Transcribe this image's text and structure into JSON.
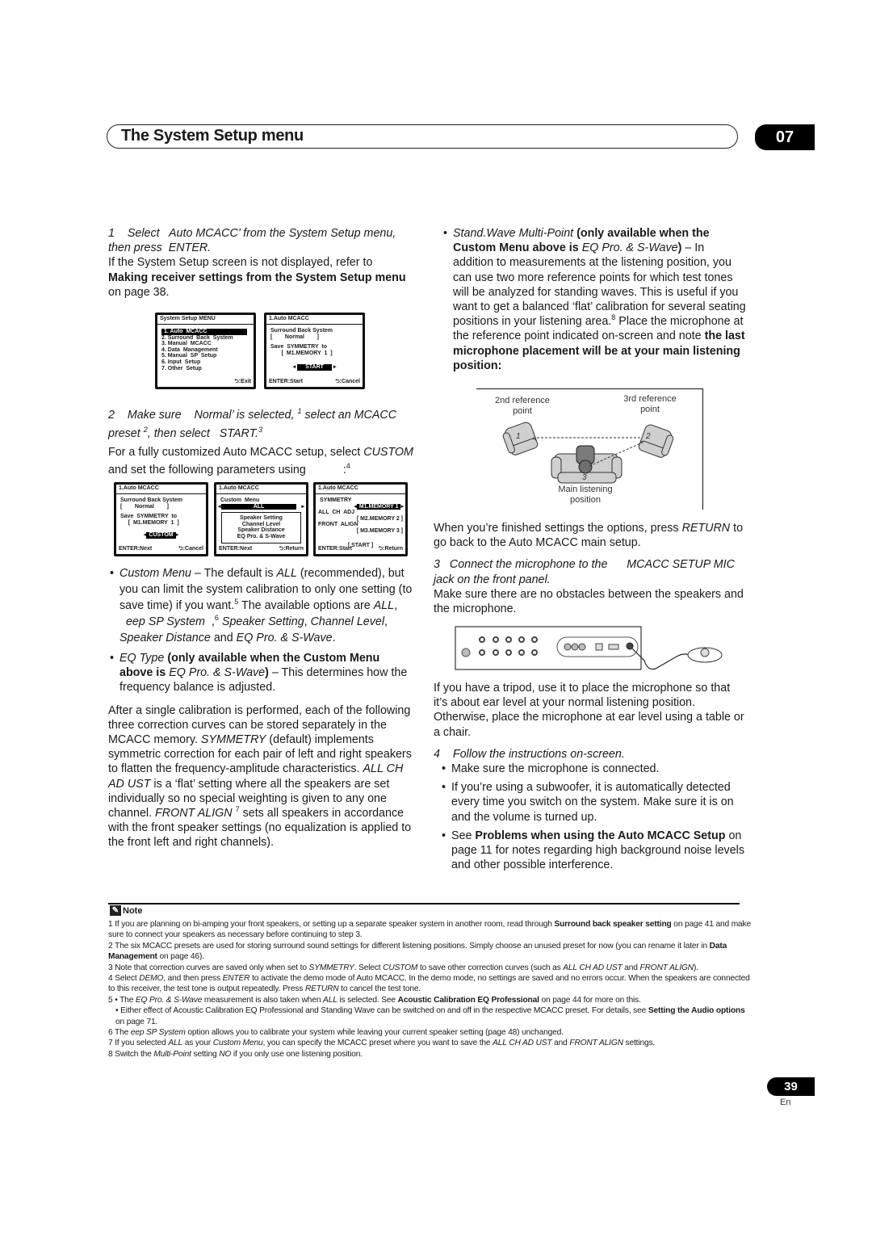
{
  "header": {
    "title": "The System Setup menu",
    "chapter": "07"
  },
  "left": {
    "step1": {
      "num": "1",
      "text_a": "Select",
      "item": "Auto MCACC",
      "text_b": "’ from the System Setup menu, then press",
      "key": "ENTER",
      "end": "."
    },
    "step1_body": {
      "a": "If the System Setup screen is not displayed, refer to",
      "link": "Making receiver settings from the System Setup menu",
      "b": "on page 38."
    },
    "osd1": {
      "title": "System  Setup  MENU",
      "items": [
        "1. Auto  MCACC",
        "2. Surround  Back  System",
        "3. Manual  MCACC",
        "4. Data  Management",
        "5. Manual  SP  Setup",
        "6. Input  Setup",
        "7. Other  Setup"
      ],
      "footer_right": ":Exit"
    },
    "osd2": {
      "title": "1.Auto  MCACC",
      "lines": [
        "Surround Back System",
        "[        Normal        ]",
        "",
        "Save  SYMMETRY  to",
        "       [  M1.MEMORY  1  ]"
      ],
      "button": "START",
      "footer_left": "ENTER:Start",
      "footer_right": ":Cancel"
    },
    "step2": {
      "num": "2",
      "a": "Make sure",
      "val": "Normal",
      "b": "’ is selected,",
      "sup1": "1",
      "c": "select an MCACC preset",
      "sup2": "2",
      "d": ", then select",
      "start": "START",
      "sup3": "3"
    },
    "step2_body": {
      "a": "For a fully customized Auto MCACC setup, select",
      "custom": "CUSTOM",
      "b": "and set the following parameters using",
      "c": ":",
      "sup": "4"
    },
    "osd3": {
      "title": "1.Auto  MCACC",
      "lines": [
        "Surround Back System",
        "[        Normal        ]",
        "",
        "Save  SYMMETRY  to",
        "     [  M1.MEMORY  1  ]"
      ],
      "button": "CUSTOM",
      "footer_left": "ENTER:Next",
      "footer_right": ":Cancel"
    },
    "osd4": {
      "title": "1.Auto  MCACC",
      "label": "Custom  Menu",
      "value": "ALL",
      "box": [
        "Speaker  Setting",
        "Channel  Level",
        "Speaker  Distance",
        "EQ  Pro. & S-Wave"
      ],
      "footer_left": "ENTER:Next",
      "footer_right": ":Return"
    },
    "osd5": {
      "title": "1.Auto  MCACC",
      "sym_label": "SYMMETRY",
      "sym_value": "M1.MEMORY  1",
      "allch_label": "ALL  CH  ADJ",
      "allch_value": "[  M2.MEMORY  2  ]",
      "front_label": "FRONT  ALIGN",
      "front_value": "[  M3.MEMORY  3  ]",
      "start": "[     START     ]",
      "footer_left": "ENTER:Start",
      "footer_right": ":Return"
    },
    "bullet_custom": {
      "term": "Custom Menu",
      "a": " – The default is ",
      "all": "ALL",
      "b": " (recommended), but you can limit the system calibration to only one setting (to save time) if you want.",
      "sup5": "5",
      "c": " The available options are ",
      "opts_all": "ALL",
      "d": ", ",
      "keep": "eep SP System",
      "e": ",",
      "sup6": "6",
      "f": " ",
      "opts_rest": "Speaker Setting",
      "g": ", ",
      "cl": "Channel Level",
      "h": ", ",
      "sd": "Speaker Distance",
      "i": " and ",
      "eq": "EQ Pro. & S-Wave",
      "j": "."
    },
    "bullet_eq": {
      "term": "EQ Type",
      "bold_a": " (only available when the Custom Menu above is ",
      "val": "EQ Pro. & S-Wave",
      "bold_b": ")",
      "rest": " – This determines how the frequency balance is adjusted."
    },
    "para": {
      "a": "After a single calibration is performed, each of the following three correction curves can be stored separately in the MCACC memory. ",
      "sym": "SYMMETRY",
      "b": " (default) implements symmetric correction for each pair of left and right speakers to flatten the frequency-amplitude characteristics. ",
      "allch": "ALL CH AD UST",
      "c": " is a ‘flat’ setting where all the speakers are set individually so no special weighting is given to any one channel. ",
      "front": "FRONT ALIGN",
      "sup7": "7",
      "d": " sets all speakers in accordance with the front speaker settings (no equalization is applied to the front left and right channels)."
    }
  },
  "right": {
    "bullet_sw": {
      "term": "Stand.Wave Multi-Point",
      "bold_a": " (only available when the Custom Menu above is ",
      "val": "EQ Pro. & S-Wave",
      "bold_b": ")",
      "a": " – In addition to measurements at the listening position, you can use two more reference points for which test tones will be analyzed for standing waves. This is useful if you want to get a balanced ‘flat’ calibration for several seating positions in your listening area.",
      "sup8": "8",
      "b": " Place the microphone at the reference point indicated on-screen and note ",
      "bold_c": "the last microphone placement will be at your main listening position:"
    },
    "diagram": {
      "label_2nd": "2nd reference point",
      "label_3rd": "3rd reference point",
      "num1": "1",
      "num2": "2",
      "num3": "3",
      "label_main": "Main listening position"
    },
    "finish": {
      "a": "When you’re finished settings the options, press ",
      "ret": "RETURN",
      "b": " to go back to the Auto MCACC main setup."
    },
    "step3": {
      "num": "3",
      "a": "Connect the microphone to the",
      "jack": "MCACC SETUP MIC",
      "b": "jack on the front panel."
    },
    "step3_body": "Make sure there are no obstacles between the speakers and the microphone.",
    "tripod": "If you have a tripod, use it to place the microphone so that it’s about ear level at your normal listening position. Otherwise, place the microphone at ear level using a table or a chair.",
    "step4": {
      "num": "4",
      "text": "Follow the instructions on-screen."
    },
    "bullets4": [
      {
        "text": "Make sure the microphone is connected."
      },
      {
        "text": "If you’re using a subwoofer, it is automatically detected every time you switch on the system. Make sure it is on and the volume is turned up."
      }
    ],
    "bullet_see": {
      "a": "See ",
      "link": "Problems when using the Auto MCACC Setup",
      "b": " on page 11 for notes regarding high background noise levels and other possible interference."
    }
  },
  "notes": {
    "heading": "Note",
    "n1": {
      "a": "1  If you are planning on bi-amping your front speakers, or setting up a separate speaker system in another room, read through ",
      "link": "Surround back speaker setting",
      "b": " on page 41 and make sure to connect your speakers as necessary before continuing to step 3."
    },
    "n2": {
      "a": "2  The six MCACC presets are used for storing surround sound settings for different listening positions. Simply choose an unused preset for now (you can rename it later in ",
      "link": "Data Management",
      "b": " on page 46)."
    },
    "n3": {
      "a": "3  Note that correction curves are saved only when set to ",
      "sym": "SYMMETRY",
      "b": ". Select ",
      "custom": "CUSTOM",
      "c": " to save other correction curves (such as ",
      "allch": "ALL CH AD UST",
      "d": " and ",
      "front": "FRONT ALIGN",
      "e": ")."
    },
    "n4": {
      "a": "4  Select ",
      "demo": "DEMO",
      "b": ", and then press ",
      "enter": "ENTER",
      "c": " to activate the demo mode of Auto MCACC. In the demo mode, no settings are saved and no errors occur. When the speakers are connected to this receiver, the test tone is output repeatedly. Press ",
      "ret": "RETURN",
      "d": " to cancel the test tone."
    },
    "n5a": {
      "a": "5  • The ",
      "eq": "EQ Pro. & S-Wave",
      "b": " measurement is also taken when ",
      "all": "ALL",
      "c": " is selected. See ",
      "link": "Acoustic Calibration EQ Professional",
      "d": " on page 44 for more on this."
    },
    "n5b": {
      "a": "• Either effect of Acoustic Calibration EQ Professional and Standing Wave can be switched on and off in the respective MCACC preset. For details, see ",
      "link": "Setting the Audio options",
      "b": " on page 71."
    },
    "n6": {
      "a": "6  The ",
      "keep": "eep SP System",
      "b": " option allows you to calibrate your system while leaving your current speaker setting (page 48) unchanged."
    },
    "n7": {
      "a": "7  If you selected ",
      "all": "ALL",
      "b": " as your ",
      "cm": "Custom Menu",
      "c": ", you can specify the MCACC preset where you want to save the ",
      "allch": "ALL CH AD UST",
      "d": " and ",
      "front": "FRONT ALIGN",
      "e": " settings."
    },
    "n8": {
      "a": "8  Switch the ",
      "mp": "Multi-Point",
      "b": " setting ",
      "no": "NO",
      "c": " if you only use one listening position."
    }
  },
  "footer": {
    "page": "39",
    "lang": "En"
  }
}
